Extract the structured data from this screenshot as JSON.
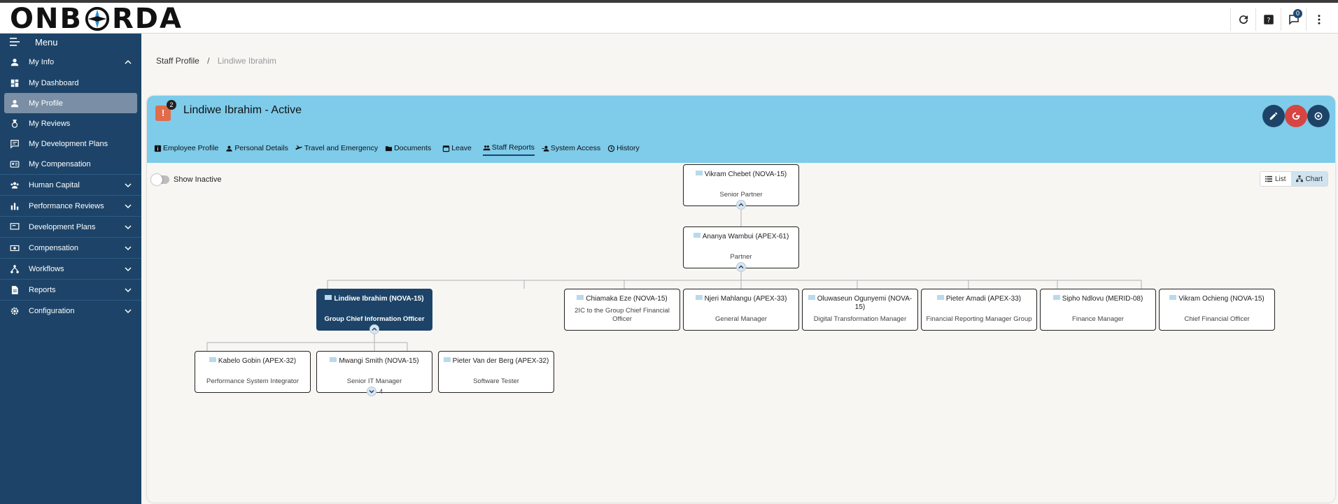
{
  "header": {
    "logo_text": "ONBORDA",
    "notification_count": "0",
    "icons": [
      "refresh-icon",
      "help-icon",
      "chat-icon",
      "more-vert-icon"
    ]
  },
  "sidebar": {
    "menu_label": "Menu",
    "items": [
      {
        "label": "My Info",
        "icon": "person-icon",
        "expanded": true
      },
      {
        "label": "My Dashboard",
        "icon": "dashboard-icon"
      },
      {
        "label": "My Profile",
        "icon": "person-icon",
        "active": true
      },
      {
        "label": "My Reviews",
        "icon": "medal-icon"
      },
      {
        "label": "My Development Plans",
        "icon": "notes-icon"
      },
      {
        "label": "My Compensation",
        "icon": "badge-icon"
      },
      {
        "label": "Human Capital",
        "icon": "group-icon"
      },
      {
        "label": "Performance Reviews",
        "icon": "bar-chart-icon"
      },
      {
        "label": "Development Plans",
        "icon": "presentation-icon"
      },
      {
        "label": "Compensation",
        "icon": "money-icon"
      },
      {
        "label": "Workflows",
        "icon": "workflow-icon"
      },
      {
        "label": "Reports",
        "icon": "report-icon"
      },
      {
        "label": "Configuration",
        "icon": "gear-icon"
      }
    ]
  },
  "breadcrumb": {
    "parent": "Staff Profile",
    "separator": "/",
    "current": "Lindiwe Ibrahim"
  },
  "profile": {
    "alert_symbol": "!",
    "alert_count": "2",
    "title": "Lindiwe Ibrahim - Active",
    "colors": {
      "edit": "#1d4468",
      "logout": "#d64541",
      "view": "#1d4468",
      "header_bg": "#7ecbea"
    }
  },
  "tabs": [
    {
      "label": "Employee Profile",
      "icon": "info-icon"
    },
    {
      "label": "Personal Details",
      "icon": "person-icon"
    },
    {
      "label": "Travel and Emergency",
      "icon": "plane-icon"
    },
    {
      "label": "Documents",
      "icon": "folder-icon"
    },
    {
      "label": "Leave",
      "icon": "calendar-icon"
    },
    {
      "label": "Staff Reports",
      "icon": "people-icon",
      "active": true
    },
    {
      "label": "System Access",
      "icon": "person-key-icon"
    },
    {
      "label": "History",
      "icon": "history-icon"
    }
  ],
  "controls": {
    "show_inactive_label": "Show Inactive",
    "show_inactive": false,
    "view_list_label": "List",
    "view_chart_label": "Chart",
    "active_view": "Chart"
  },
  "org": {
    "top": {
      "name": "Vikram Chebet (NOVA-15)",
      "title": "Senior Partner"
    },
    "partner": {
      "name": "Ananya Wambui (APEX-61)",
      "title": "Partner"
    },
    "selected": {
      "name": "Lindiwe Ibrahim (NOVA-15)",
      "title": "Group Chief Information Officer"
    },
    "peers": [
      {
        "name": "Chiamaka Eze (NOVA-15)",
        "title": "2IC to the Group Chief Financial Officer"
      },
      {
        "name": "Njeri Mahlangu (APEX-33)",
        "title": "General Manager"
      },
      {
        "name": "Oluwaseun Ogunyemi (NOVA-15)",
        "title": "Digital Transformation Manager"
      },
      {
        "name": "Pieter Amadi (APEX-33)",
        "title": "Financial Reporting Manager Group"
      },
      {
        "name": "Sipho Ndlovu (MERID-08)",
        "title": "Finance Manager"
      },
      {
        "name": "Vikram Ochieng (NOVA-15)",
        "title": "Chief Financial Officer"
      }
    ],
    "reports": [
      {
        "name": "Kabelo Gobin (APEX-32)",
        "title": "Performance System Integrator"
      },
      {
        "name": "Mwangi Smith (NOVA-15)",
        "title": "Senior IT Manager"
      },
      {
        "name": "Pieter Van der Berg (APEX-32)",
        "title": "Software Tester"
      }
    ],
    "more_reports_count": "4"
  }
}
